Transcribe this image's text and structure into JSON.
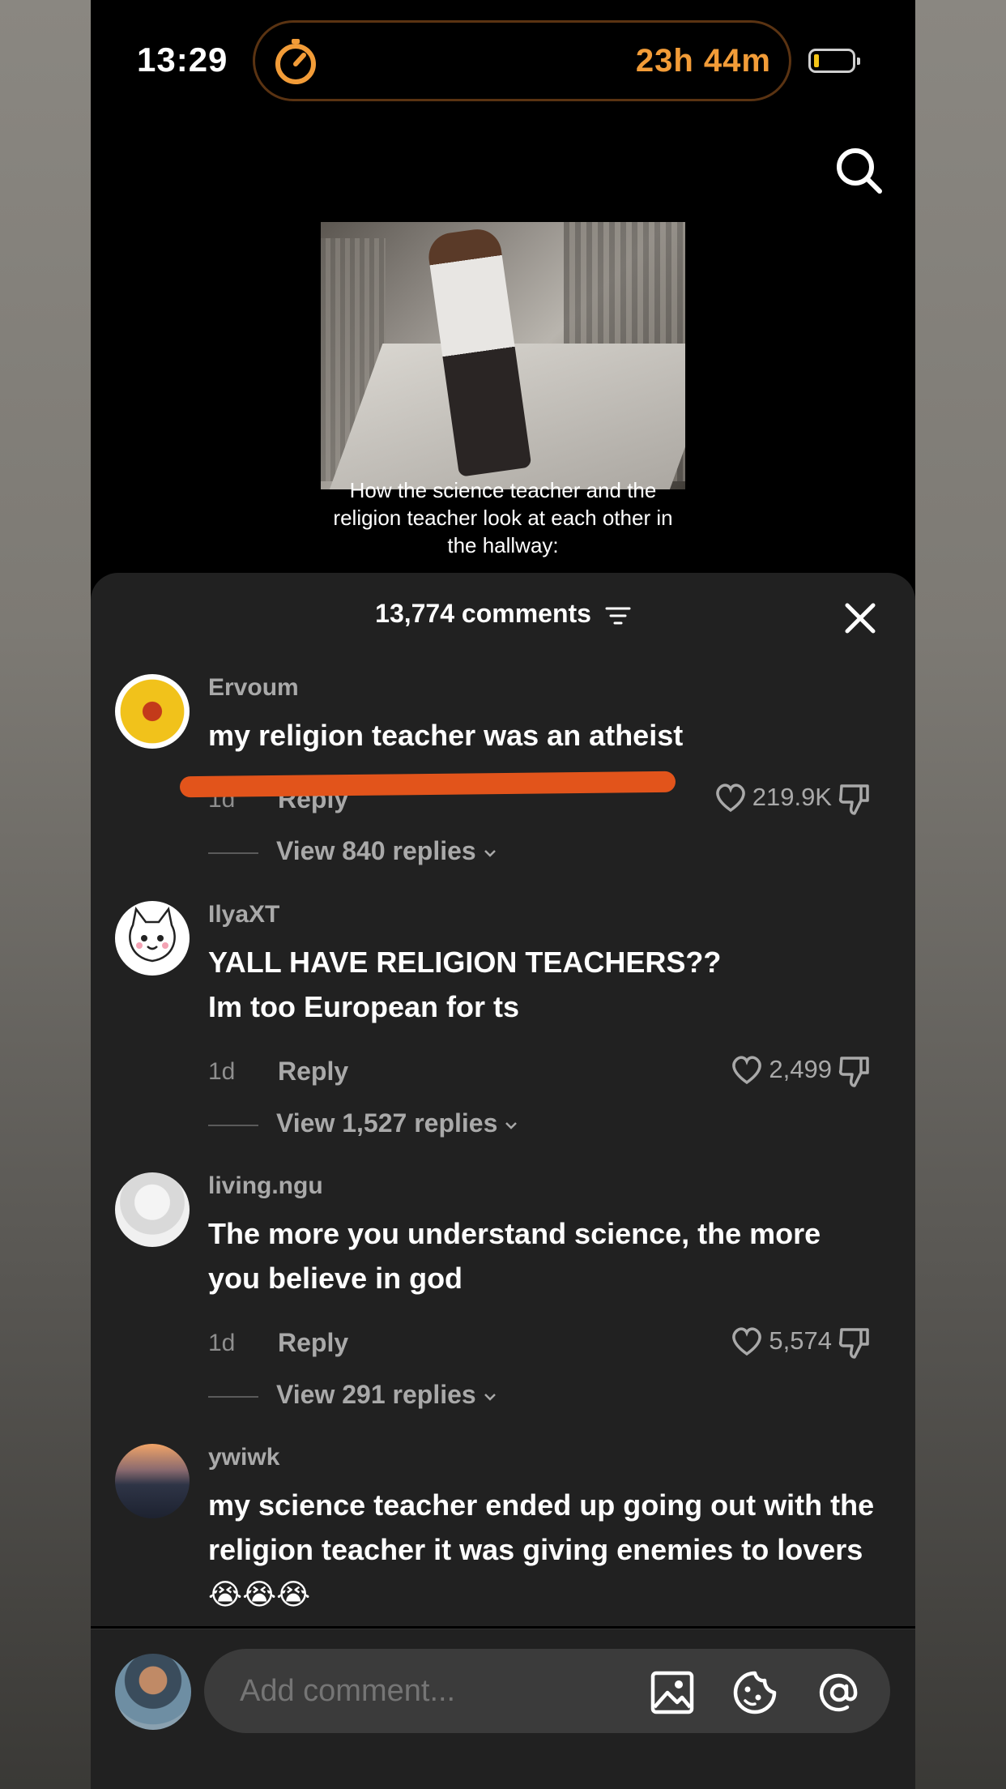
{
  "status_bar": {
    "time": "13:29",
    "timer": "23h 44m",
    "accent_color": "#f29c38"
  },
  "video": {
    "caption": "How the science teacher and the religion teacher look at each other in the hallway:"
  },
  "comments_sheet": {
    "header": "13,774 comments",
    "comments": [
      {
        "username": "Ervoum",
        "text": "my religion teacher was an atheist",
        "age": "1d",
        "reply_label": "Reply",
        "likes": "219.9K",
        "view_replies": "View 840 replies"
      },
      {
        "username": "IlyaXT",
        "text": "YALL HAVE RELIGION TEACHERS??",
        "text_line2": "Im too European for ts",
        "age": "1d",
        "reply_label": "Reply",
        "likes": "2,499",
        "view_replies": "View 1,527 replies"
      },
      {
        "username": "living.ngu",
        "text": "The more you understand science, the more you believe in god",
        "age": "1d",
        "reply_label": "Reply",
        "likes": "5,574",
        "view_replies": "View 291 replies"
      },
      {
        "username": "ywiwk",
        "text": "my science teacher ended up going out with the religion teacher it was giving enemies to lovers",
        "emojis": "😭😭😭"
      }
    ]
  },
  "composer": {
    "placeholder": "Add comment..."
  }
}
